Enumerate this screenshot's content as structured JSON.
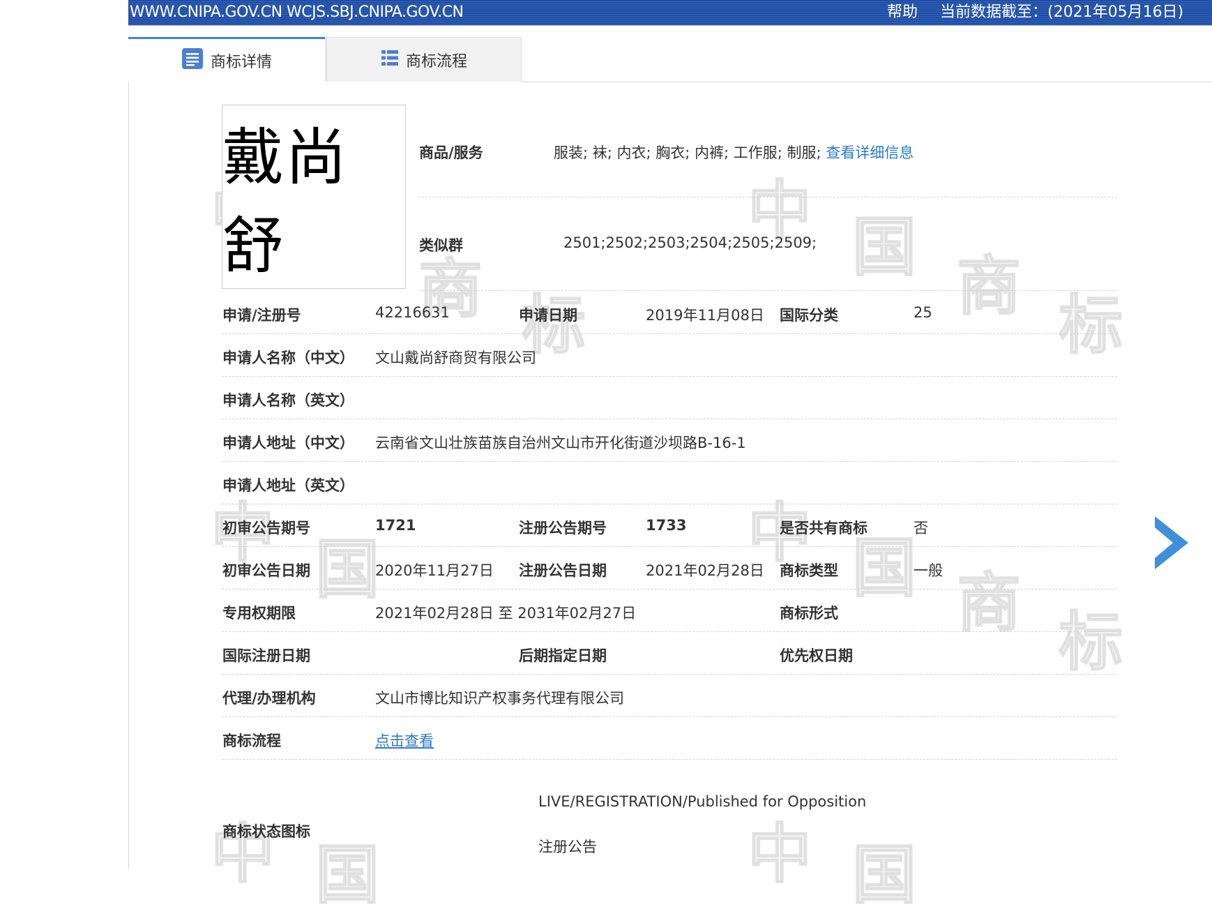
{
  "header": {
    "site_urls": "WWW.CNIPA.GOV.CN WCJS.SBJ.CNIPA.GOV.CN",
    "help": "帮助",
    "data_date": "当前数据截至：(2021年05月16日)"
  },
  "tabs": [
    {
      "label": "商标详情",
      "active": true,
      "icon": "document-list-icon"
    },
    {
      "label": "商标流程",
      "active": false,
      "icon": "list-icon"
    }
  ],
  "watermark": [
    "中",
    "国",
    "商",
    "标"
  ],
  "trademark_image_text": "戴尚舒",
  "goods": {
    "label": "商品/服务",
    "value": "服装; 袜; 内衣; 胸衣; 内裤; 工作服; 制服;",
    "link": "查看详细信息"
  },
  "similar_group": {
    "label": "类似群",
    "value": "2501;2502;2503;2504;2505;2509;"
  },
  "fields": {
    "reg_no": {
      "label": "申请/注册号",
      "value": "42216631"
    },
    "apply_date": {
      "label": "申请日期",
      "value": "2019年11月08日"
    },
    "intl_class": {
      "label": "国际分类",
      "value": "25"
    },
    "applicant_cn": {
      "label": "申请人名称（中文）",
      "value": "文山戴尚舒商贸有限公司"
    },
    "applicant_en": {
      "label": "申请人名称（英文）",
      "value": ""
    },
    "address_cn": {
      "label": "申请人地址（中文）",
      "value": "云南省文山壮族苗族自治州文山市开化街道沙坝路B-16-1"
    },
    "address_en": {
      "label": "申请人地址（英文）",
      "value": ""
    },
    "prelim_issue": {
      "label": "初审公告期号",
      "value": "1721"
    },
    "reg_issue": {
      "label": "注册公告期号",
      "value": "1733"
    },
    "shared": {
      "label": "是否共有商标",
      "value": "否"
    },
    "prelim_date": {
      "label": "初审公告日期",
      "value": "2020年11月27日"
    },
    "reg_date": {
      "label": "注册公告日期",
      "value": "2021年02月28日"
    },
    "mark_type": {
      "label": "商标类型",
      "value": "一般"
    },
    "exclusive": {
      "label": "专用权期限",
      "value": "2021年02月28日 至 2031年02月27日"
    },
    "mark_form": {
      "label": "商标形式",
      "value": ""
    },
    "intl_reg_date": {
      "label": "国际注册日期",
      "value": ""
    },
    "later_date": {
      "label": "后期指定日期",
      "value": ""
    },
    "priority_date": {
      "label": "优先权日期",
      "value": ""
    },
    "agent": {
      "label": "代理/办理机构",
      "value": "文山市博比知识产权事务代理有限公司"
    },
    "flow": {
      "label": "商标流程",
      "link": "点击查看"
    },
    "status": {
      "label": "商标状态图标",
      "value_en": "LIVE/REGISTRATION/Published for Opposition",
      "value_cn": "注册公告"
    }
  },
  "colors": {
    "banner": "#1f4fa8",
    "link": "#2d7bc4",
    "tab_accent": "#4a7fd3",
    "arrow": "#3f8fd9"
  }
}
